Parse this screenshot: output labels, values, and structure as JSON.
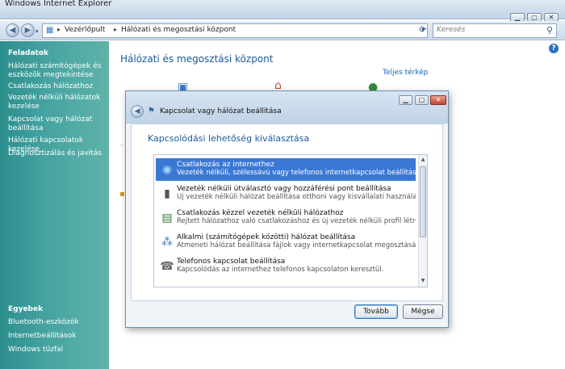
{
  "window": {
    "title": "Windows Internet Explorer"
  },
  "address_bar": {
    "crumbs": [
      "Vezérlőpult",
      "Hálózati és megosztási központ"
    ],
    "search_placeholder": "Keresés"
  },
  "sidebar": {
    "tasks_heading": "Feladatok",
    "tasks": [
      "Hálózati számítógépek és eszközök megtekintése",
      "Csatlakozás hálózathoz",
      "Vezeték nélküli hálózatok kezelése",
      "Kapcsolat vagy hálózat beállítása",
      "Hálózati kapcsolatok kezelése",
      "Diagnosztizálás és javítás"
    ],
    "other_heading": "Egyebek",
    "other": [
      "Bluetooth-eszközök",
      "Internetbeállítások",
      "Windows tűzfal"
    ]
  },
  "main": {
    "title": "Hálózati és megosztási központ",
    "full_map_link": "Teljes térkép"
  },
  "dialog": {
    "title": "Kapcsolat vagy hálózat beállítása",
    "heading": "Kapcsolódási lehetőség kiválasztása",
    "options": [
      {
        "title": "Csatlakozás az internethez",
        "desc": "Vezeték nélküli, szélessávú vagy telefonos internetkapcsolat beállítása.",
        "icon": "globe-icon",
        "selected": true
      },
      {
        "title": "Vezeték nélküli útválasztó vagy hozzáférési pont beállítása",
        "desc": "Új vezeték nélküli hálózat beállítása otthoni vagy kisvállalati használatra.",
        "icon": "router-icon",
        "selected": false
      },
      {
        "title": "Csatlakozás kézzel vezeték nélküli hálózathoz",
        "desc": "Rejtett hálózathoz való csatlakozáshoz és új vezeték nélküli profil létrehozásához válassz...",
        "icon": "wireless-network-icon",
        "selected": false
      },
      {
        "title": "Alkalmi (számítógépek közötti) hálózat beállítása",
        "desc": "Átmeneti hálózat beállítása fájlok vagy internetkapcsolat megosztásához.",
        "icon": "adhoc-network-icon",
        "selected": false
      },
      {
        "title": "Telefonos kapcsolat beállítása",
        "desc": "Kapcsolódás az internethez telefonos kapcsolaton keresztül.",
        "icon": "phone-icon",
        "selected": false
      }
    ],
    "next_label": "Tovább",
    "cancel_label": "Mégse"
  }
}
